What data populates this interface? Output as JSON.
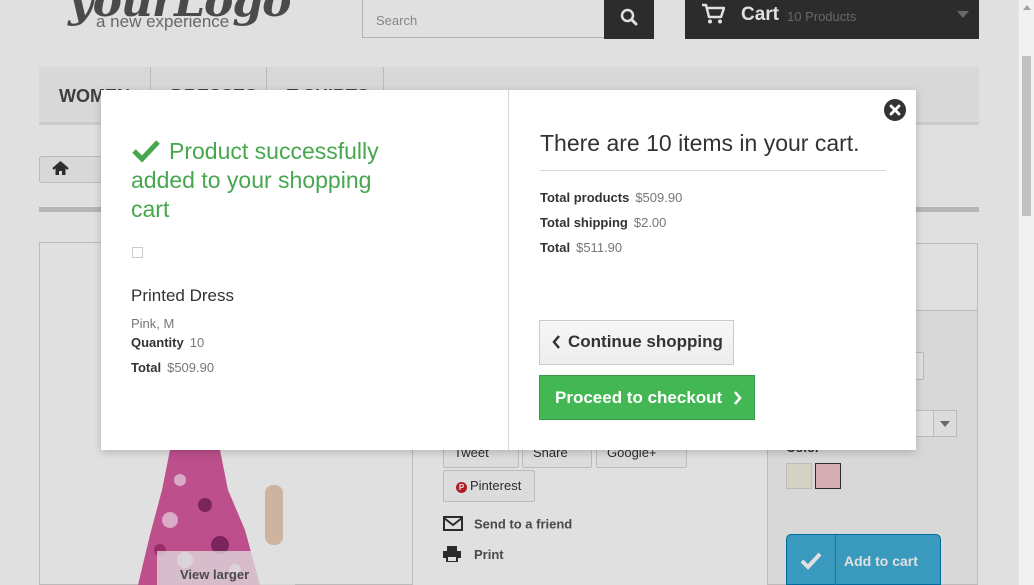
{
  "header": {
    "logo_script": "yourLogo",
    "logo_tagline": "a new experience",
    "search_placeholder": "Search",
    "cart_label": "Cart",
    "cart_count": "10 Products"
  },
  "menu": {
    "items": [
      {
        "label": "Women"
      },
      {
        "label": "Dresses"
      },
      {
        "label": "T-shirts"
      }
    ]
  },
  "product_page": {
    "view_larger": "View larger",
    "share": {
      "tweet": "Tweet",
      "share": "Share",
      "google": "Google+",
      "pinterest": "Pinterest"
    },
    "send_to_friend": "Send to a friend",
    "print": "Print",
    "color_label": "Color",
    "swatch_colors": [
      "#f3f0dc",
      "#f2c7cb"
    ],
    "add_to_cart": "Add to cart"
  },
  "modal": {
    "success_message": "Product successfully added to your shopping cart",
    "product_name": "Printed Dress",
    "product_attributes": "Pink, M",
    "quantity_label": "Quantity",
    "quantity_value": "10",
    "total_label": "Total",
    "total_value": "$509.90",
    "cart_summary": "There are 10 items in your cart.",
    "total_products_label": "Total products",
    "total_products_value": "$509.90",
    "total_shipping_label": "Total shipping",
    "total_shipping_value": "$2.00",
    "grand_total_label": "Total",
    "grand_total_value": "$511.90",
    "continue_label": "Continue shopping",
    "checkout_label": "Proceed to checkout"
  },
  "colors": {
    "success_green": "#46a74e",
    "checkout_green": "#43b754",
    "add_to_cart_blue": "#43b0d8",
    "dark": "#333333"
  }
}
